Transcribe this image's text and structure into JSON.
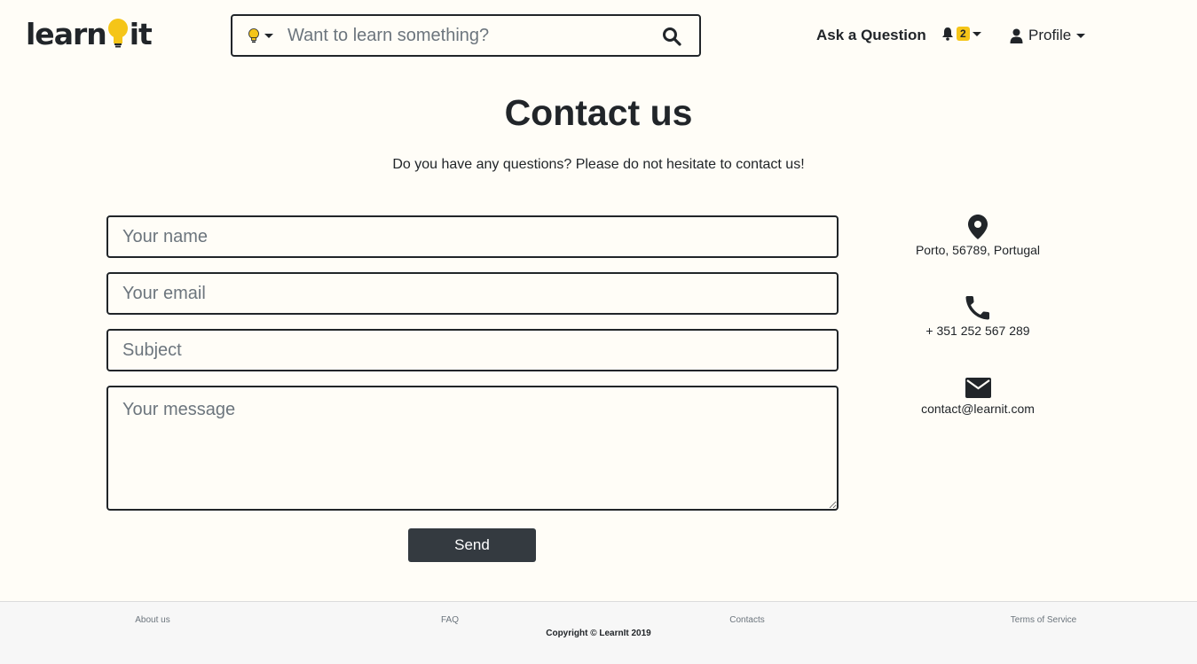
{
  "header": {
    "logo_left": "learn",
    "logo_right": "it",
    "search": {
      "placeholder": "Want to learn something?"
    },
    "ask_label": "Ask a Question",
    "notifications_count": "2",
    "profile_label": "Profile"
  },
  "main": {
    "title": "Contact us",
    "subtitle": "Do you have any questions? Please do not hesitate to contact us!"
  },
  "form": {
    "name_placeholder": "Your name",
    "email_placeholder": "Your email",
    "subject_placeholder": "Subject",
    "message_placeholder": "Your message",
    "send_label": "Send"
  },
  "contact_info": {
    "address": "Porto, 56789, Portugal",
    "phone": "+ 351 252 567 289",
    "email": "contact@learnit.com"
  },
  "footer": {
    "links": [
      "About us",
      "FAQ",
      "Contacts",
      "Terms of Service"
    ],
    "copyright": "Copyright © LearnIt 2019"
  },
  "colors": {
    "background": "#fffdf7",
    "accent": "#f5c518",
    "dark": "#212529",
    "button": "#343a40",
    "footer": "#f7f7f7"
  },
  "icons": [
    "lightbulb-icon",
    "search-icon",
    "bell-icon",
    "user-icon",
    "map-marker-icon",
    "phone-icon",
    "envelope-icon"
  ]
}
